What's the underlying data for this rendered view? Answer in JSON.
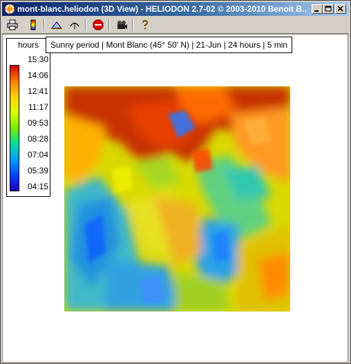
{
  "window": {
    "title": "mont-blanc.heliodon (3D View)  - HELIODON 2.7-02 © 2003-2010 Benoit B..."
  },
  "title_buttons": [
    "minimize-icon",
    "maximize-icon",
    "close-icon"
  ],
  "toolbar": {
    "items": [
      "print-icon",
      "color-scale-icon",
      "terrain-icon",
      "sun-path-icon",
      "stop-icon",
      "camera-icon",
      "help-icon"
    ]
  },
  "legend": {
    "title": "hours",
    "ticks": [
      "15:30",
      "14:06",
      "12:41",
      "11:17",
      "09:53",
      "08:28",
      "07:04",
      "05:39",
      "04:15"
    ],
    "colors": [
      "#d40000",
      "#ff7a00",
      "#ffd200",
      "#d8ff00",
      "#78e800",
      "#00e0a0",
      "#00a0ff",
      "#0040ff",
      "#2000c0"
    ]
  },
  "caption": "Sunny period | Mont Blanc (45° 50' N) | 21-Jun | 24 hours | 5 min"
}
